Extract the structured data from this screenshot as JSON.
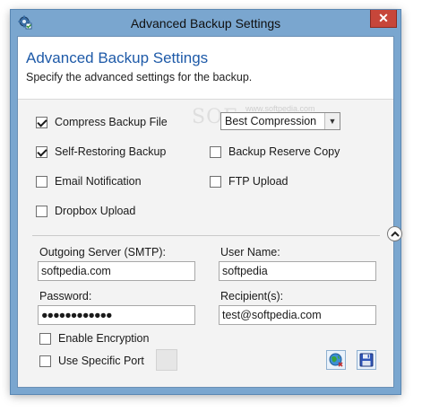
{
  "window": {
    "title": "Advanced Backup Settings",
    "close_glyph": "✕"
  },
  "header": {
    "title": "Advanced Backup Settings",
    "subtitle": "Specify the advanced settings for the backup."
  },
  "watermark": {
    "text": "SOF",
    "url": "www.softpedia.com"
  },
  "options": {
    "compress": {
      "label": "Compress Backup File",
      "checked": true
    },
    "compression_level": {
      "selected": "Best Compression"
    },
    "self_restoring": {
      "label": "Self-Restoring Backup",
      "checked": true
    },
    "reserve_copy": {
      "label": "Backup Reserve Copy",
      "checked": false
    },
    "email": {
      "label": "Email Notification",
      "checked": false
    },
    "ftp": {
      "label": "FTP Upload",
      "checked": false
    },
    "dropbox": {
      "label": "Dropbox Upload",
      "checked": false
    }
  },
  "email_settings": {
    "server_label": "Outgoing Server (SMTP):",
    "server_value": "softpedia.com",
    "username_label": "User Name:",
    "username_value": "softpedia",
    "password_label": "Password:",
    "password_value": "●●●●●●●●●●●●",
    "recipients_label": "Recipient(s):",
    "recipients_value": "test@softpedia.com",
    "encryption": {
      "label": "Enable Encryption",
      "checked": false
    },
    "specific_port": {
      "label": "Use Specific Port",
      "checked": false
    }
  },
  "icons": {
    "app": "backup-gear-icon",
    "collapse": "chevron-up-icon",
    "test": "globe-icon",
    "save": "floppy-disk-icon"
  }
}
